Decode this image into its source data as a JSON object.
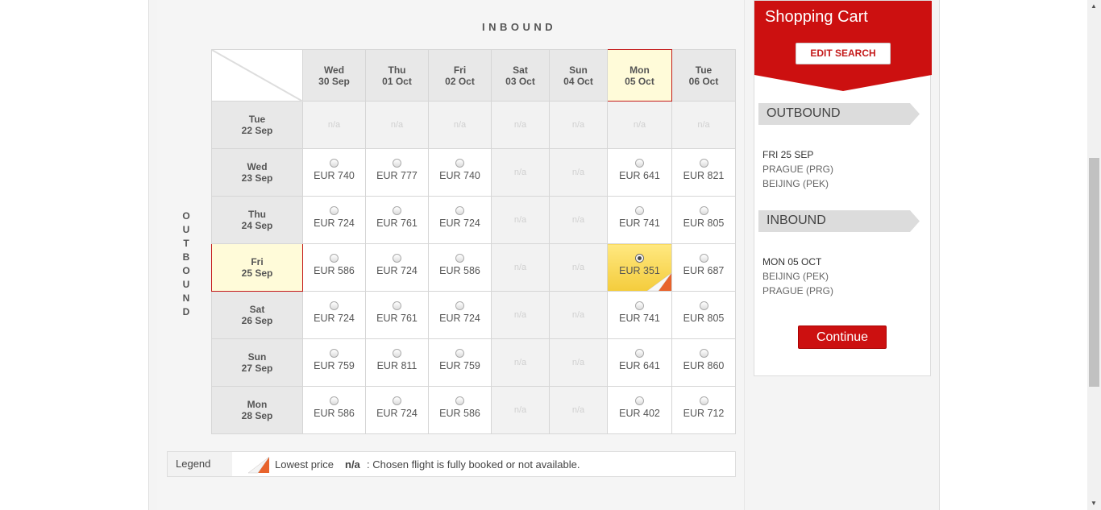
{
  "inbound_label": "INBOUND",
  "outbound_label": [
    "O",
    "U",
    "T",
    "B",
    "O",
    "U",
    "N",
    "D"
  ],
  "columns": [
    {
      "day": "Wed",
      "date": "30 Sep"
    },
    {
      "day": "Thu",
      "date": "01 Oct"
    },
    {
      "day": "Fri",
      "date": "02 Oct"
    },
    {
      "day": "Sat",
      "date": "03 Oct"
    },
    {
      "day": "Sun",
      "date": "04 Oct"
    },
    {
      "day": "Mon",
      "date": "05 Oct"
    },
    {
      "day": "Tue",
      "date": "06 Oct"
    }
  ],
  "selected_column": 5,
  "selected_row": 3,
  "rows": [
    {
      "day": "Tue",
      "date": "22 Sep",
      "prices": [
        "n/a",
        "n/a",
        "n/a",
        "n/a",
        "n/a",
        "n/a",
        "n/a"
      ]
    },
    {
      "day": "Wed",
      "date": "23 Sep",
      "prices": [
        "EUR 740",
        "EUR 777",
        "EUR 740",
        "n/a",
        "n/a",
        "EUR 641",
        "EUR 821"
      ]
    },
    {
      "day": "Thu",
      "date": "24 Sep",
      "prices": [
        "EUR 724",
        "EUR 761",
        "EUR 724",
        "n/a",
        "n/a",
        "EUR 741",
        "EUR 805"
      ]
    },
    {
      "day": "Fri",
      "date": "25 Sep",
      "prices": [
        "EUR 586",
        "EUR 724",
        "EUR 586",
        "n/a",
        "n/a",
        "EUR 351",
        "EUR 687"
      ]
    },
    {
      "day": "Sat",
      "date": "26 Sep",
      "prices": [
        "EUR 724",
        "EUR 761",
        "EUR 724",
        "n/a",
        "n/a",
        "EUR 741",
        "EUR 805"
      ]
    },
    {
      "day": "Sun",
      "date": "27 Sep",
      "prices": [
        "EUR 759",
        "EUR 811",
        "EUR 759",
        "n/a",
        "n/a",
        "EUR 641",
        "EUR 860"
      ]
    },
    {
      "day": "Mon",
      "date": "28 Sep",
      "prices": [
        "EUR 586",
        "EUR 724",
        "EUR 586",
        "n/a",
        "n/a",
        "EUR 402",
        "EUR 712"
      ]
    }
  ],
  "legend": {
    "title": "Legend",
    "lowest": "Lowest price",
    "na_key": "n/a",
    "na_desc": ": Chosen flight is fully booked or not available."
  },
  "cart": {
    "title": "Shopping Cart",
    "edit_search": "EDIT SEARCH",
    "outbound": {
      "label": "OUTBOUND",
      "date": "FRI 25 SEP",
      "from": "PRAGUE (PRG)",
      "to": "BEIJING (PEK)"
    },
    "inbound": {
      "label": "INBOUND",
      "date": "MON 05 OCT",
      "from": "BEIJING (PEK)",
      "to": "PRAGUE (PRG)"
    },
    "continue": "Continue"
  },
  "colors": {
    "accent_red": "#cc1010",
    "highlight_yellow": "#f4cc3c"
  }
}
